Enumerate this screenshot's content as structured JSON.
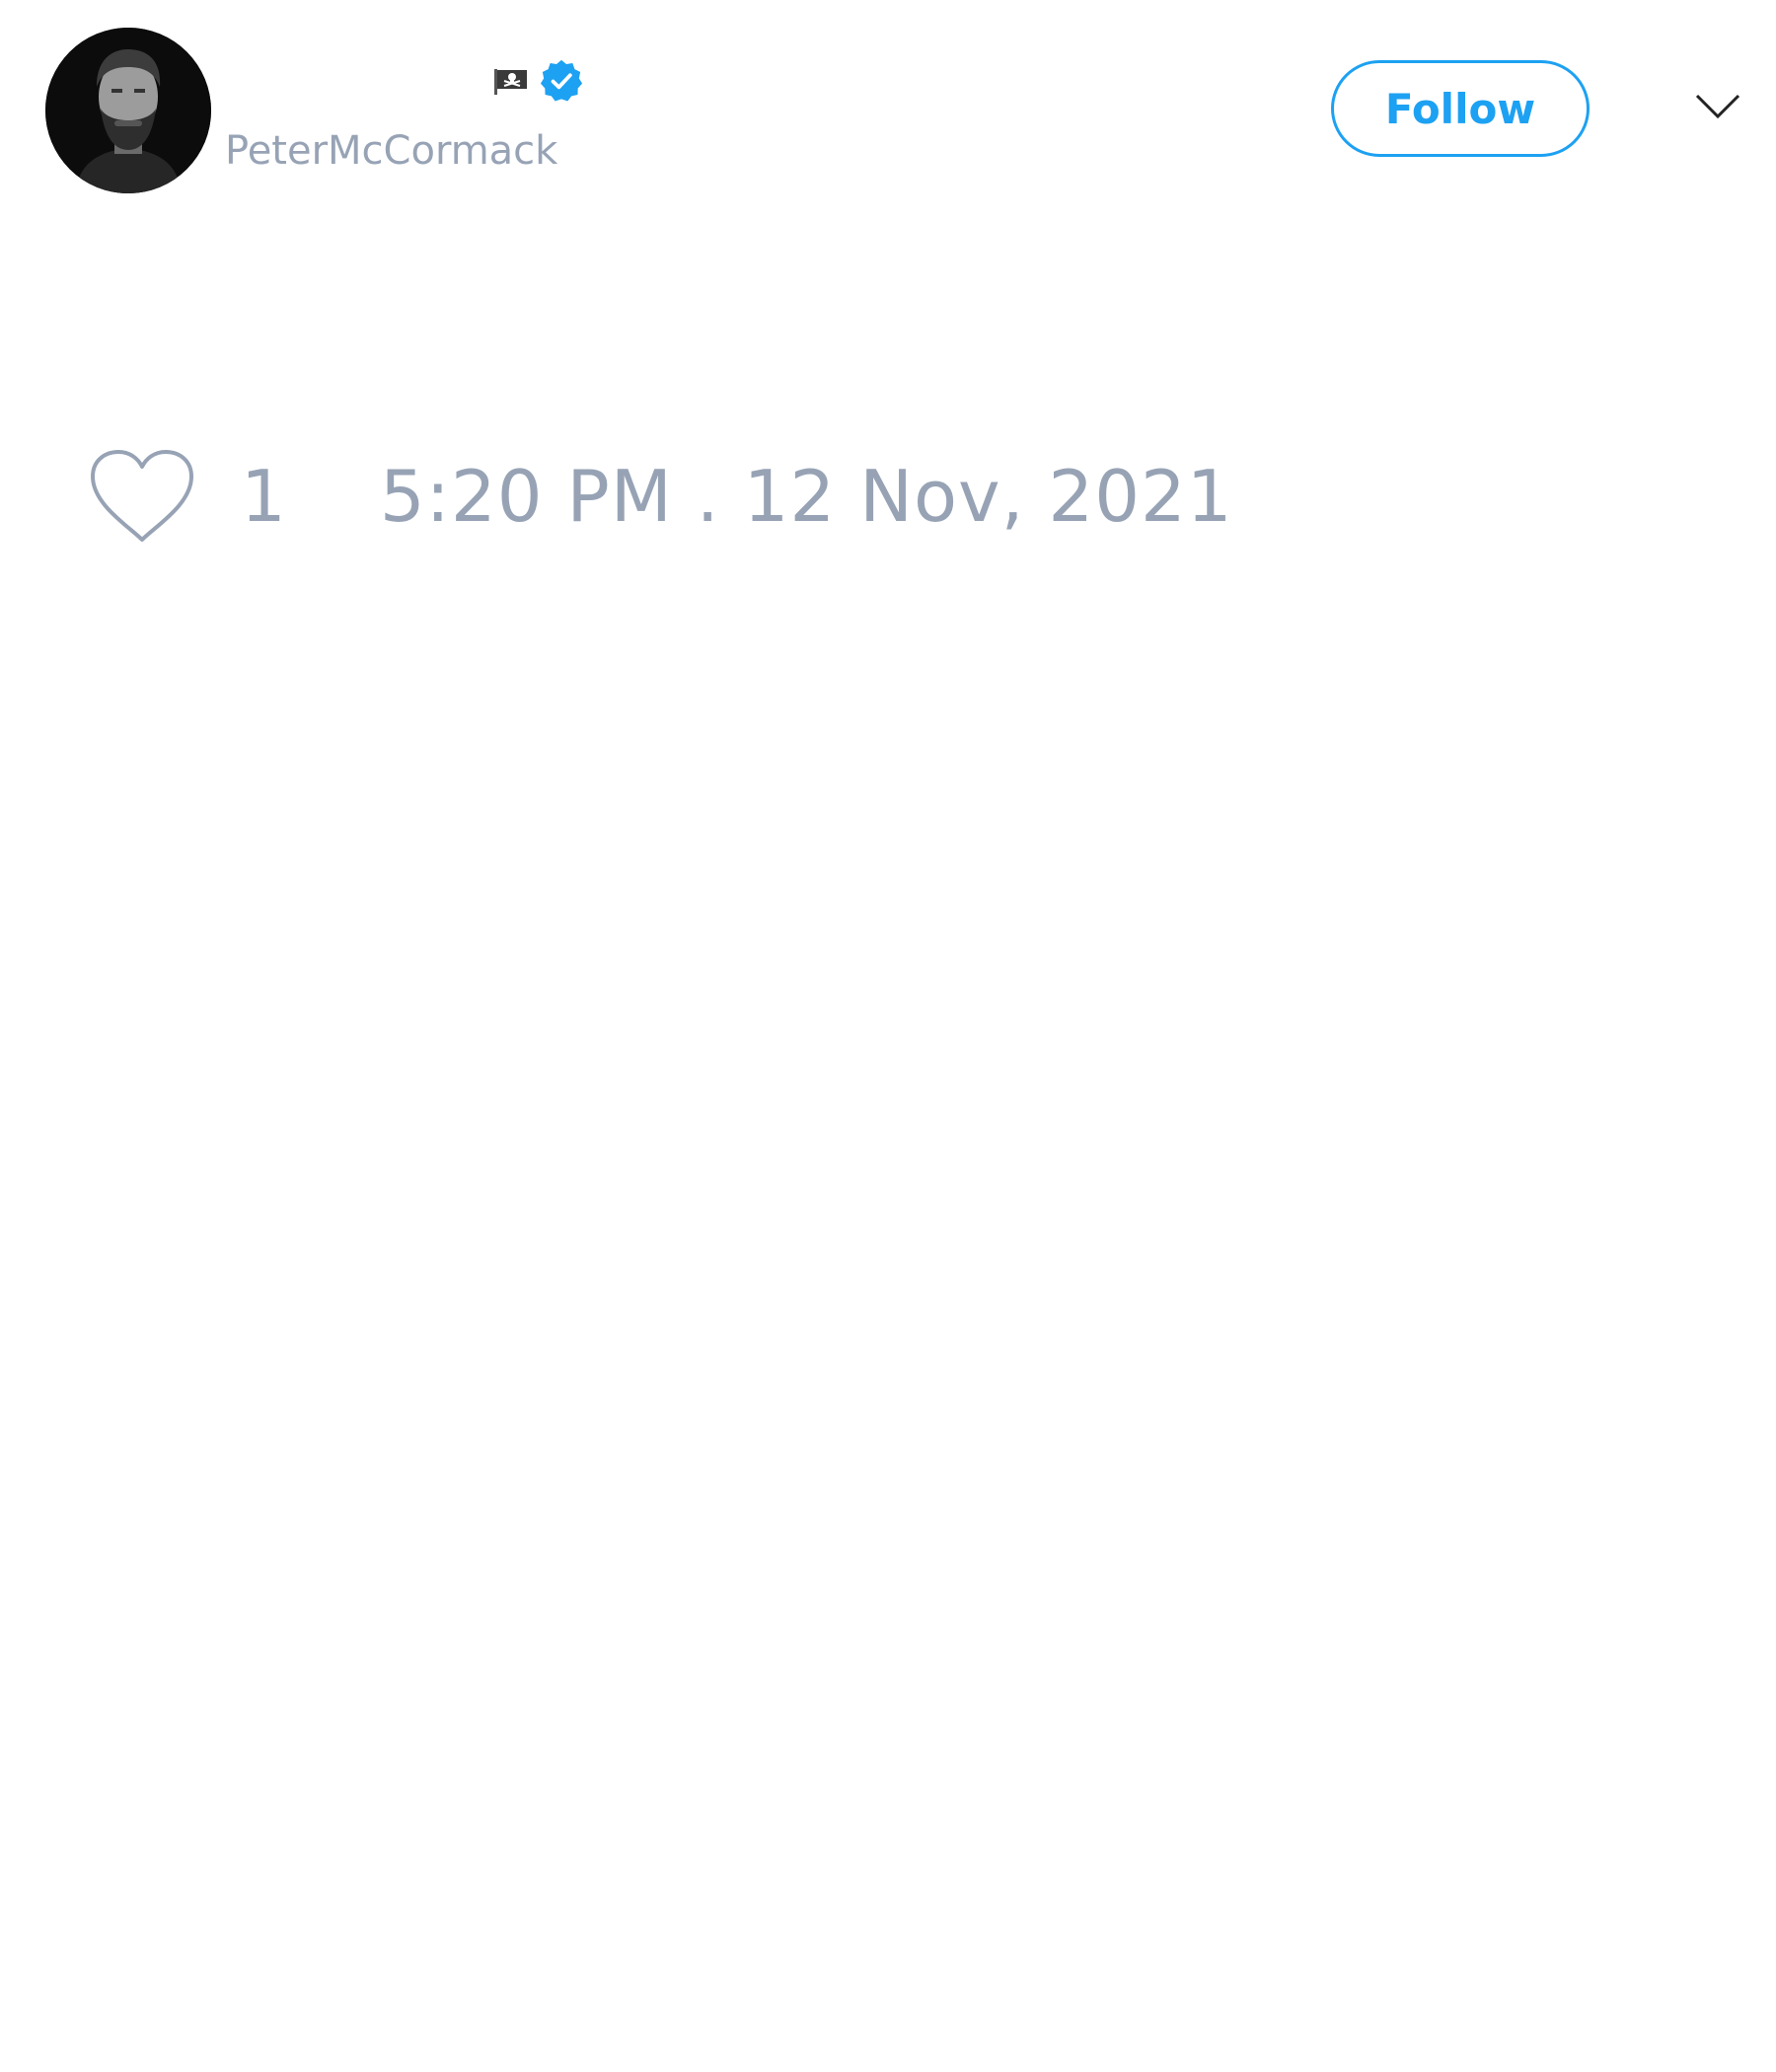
{
  "tweet": {
    "author": {
      "handle": "PeterMcCormack",
      "badges": [
        "pirate-flag-icon",
        "verified-icon"
      ],
      "avatar_icon": "user-avatar-photo"
    },
    "follow_label": "Follow",
    "menu_icon": "chevron-down-icon",
    "like_icon": "heart-icon",
    "like_count": "1",
    "timestamp": "5:20 PM . 12 Nov, 2021"
  },
  "colors": {
    "accent": "#1da1f2",
    "muted_text": "#97a3b5",
    "background": "#ffffff"
  }
}
